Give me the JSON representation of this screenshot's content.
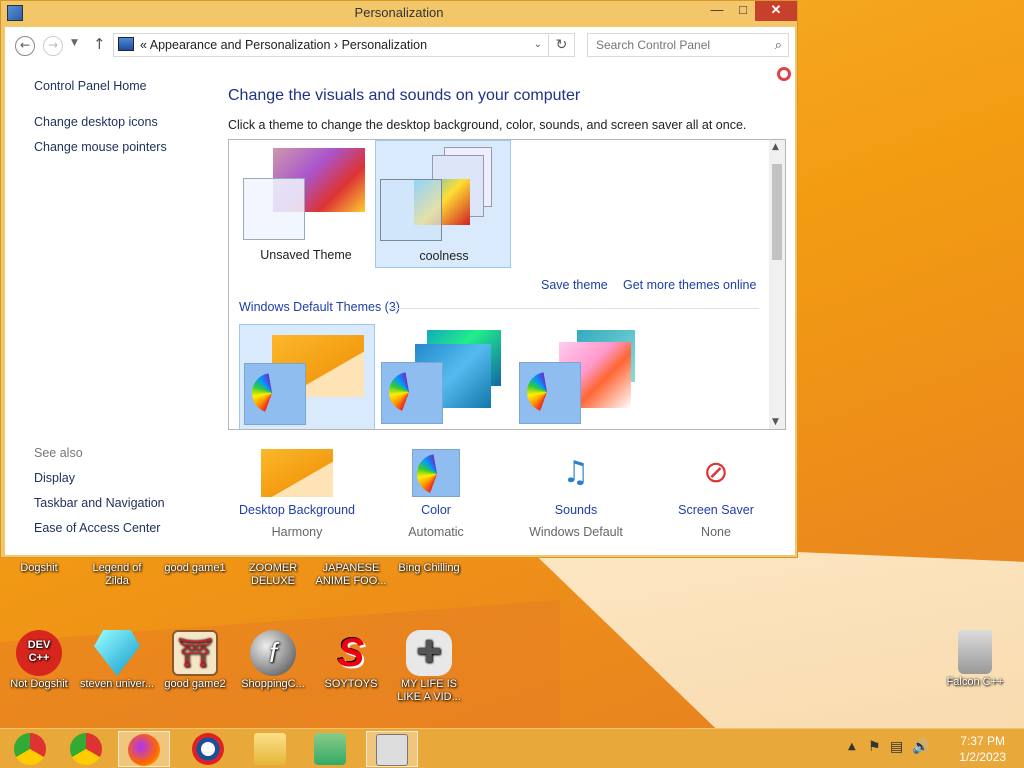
{
  "window": {
    "title": "Personalization",
    "min": "—",
    "max": "□",
    "close": "✕"
  },
  "address": {
    "prefix": "«",
    "crumb1": "Appearance and Personalization",
    "sep": "›",
    "crumb2": "Personalization",
    "search_placeholder": "Search Control Panel"
  },
  "left_pane": {
    "home": "Control Panel Home",
    "desktop_icons": "Change desktop icons",
    "mouse_pointers": "Change mouse pointers",
    "see_also": "See also",
    "display": "Display",
    "taskbar_nav": "Taskbar and Navigation",
    "ease_access": "Ease of Access Center"
  },
  "main": {
    "title": "Change the visuals and sounds on your computer",
    "subtitle": "Click a theme to change the desktop background, color, sounds, and screen saver all at once.",
    "my_themes": [
      {
        "label": "Unsaved Theme",
        "selected": false
      },
      {
        "label": "coolness",
        "selected": true
      }
    ],
    "save_theme": "Save theme",
    "get_more": "Get more themes online",
    "default_section": "Windows Default Themes (3)"
  },
  "bottom": [
    {
      "label": "Desktop Background",
      "value": "Harmony"
    },
    {
      "label": "Color",
      "value": "Automatic"
    },
    {
      "label": "Sounds",
      "value": "Windows Default"
    },
    {
      "label": "Screen Saver",
      "value": "None"
    }
  ],
  "desktop_icons": [
    {
      "label": "Dogshit"
    },
    {
      "label": "Legend of Zilda"
    },
    {
      "label": "good game1"
    },
    {
      "label": "ZOOMER DELUXE"
    },
    {
      "label": "JAPANESE ANIME FOO..."
    },
    {
      "label": "Bing Chilling"
    },
    {
      "label": "Not Dogshit"
    },
    {
      "label": "steven univer..."
    },
    {
      "label": "good game2"
    },
    {
      "label": "ShoppingC..."
    },
    {
      "label": "SOYTOYS"
    },
    {
      "label": "MY LIFE IS LIKE A VID..."
    },
    {
      "label": "Falcon C++"
    }
  ],
  "taskbar": {
    "time": "7:37 PM",
    "date": "1/2/2023"
  },
  "icons": {
    "dev_cpp": "DEV C++",
    "flash": "f",
    "soytoys": "S"
  },
  "colors": {
    "wallpaper": "#f39c12",
    "window_frame": "#f3c769",
    "link": "#1e3ea8",
    "title": "#1e3287",
    "close": "#c7402b"
  }
}
